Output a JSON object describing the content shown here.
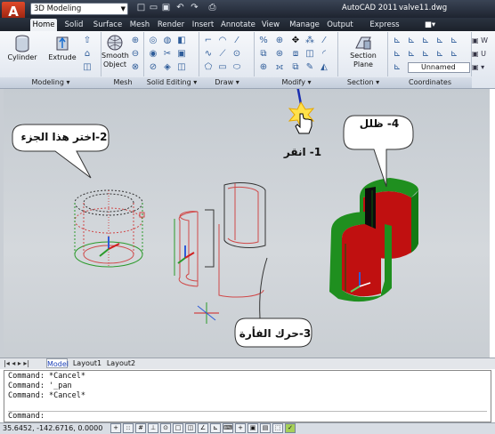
{
  "app": {
    "menu_button": "A",
    "workspace": "3D Modeling",
    "app_title": "AutoCAD 2011",
    "file_title": "valve11.dwg"
  },
  "qat": [
    "new",
    "open",
    "save",
    "undo",
    "redo",
    "plot"
  ],
  "tabs": [
    "Home",
    "Solid",
    "Surface",
    "Mesh",
    "Render",
    "Insert",
    "Annotate",
    "View",
    "Manage",
    "Output",
    "Express Tools"
  ],
  "ribbon": {
    "cylinder": "Cylinder",
    "extrude": "Extrude",
    "smooth_line1": "Smooth",
    "smooth_line2": "Object",
    "section_line1": "Section",
    "section_line2": "Plane",
    "unnamed": "Unnamed",
    "panels": [
      "Modeling ▾",
      "Mesh",
      "Solid Editing ▾",
      "Draw ▾",
      "Modify ▾",
      "Section ▾",
      "Coordinates"
    ]
  },
  "callouts": {
    "step1": "1- انقر",
    "step2": "2-اختر هذا الجزء",
    "step3": "3-حرك الفأرة",
    "step4": "4- ظلل"
  },
  "layout_tabs": [
    "Model",
    "Layout1",
    "Layout2"
  ],
  "command_lines": [
    "Command: *Cancel*",
    "Command: '_pan",
    "Command: *Cancel*",
    "",
    "Command:"
  ],
  "status": {
    "coordinates": "35.6452, -142.6716, 0.0000"
  },
  "colors": {
    "solid_green": "#1f8f1f",
    "solid_red": "#c01010",
    "accent_blue": "#1b2fb0"
  }
}
